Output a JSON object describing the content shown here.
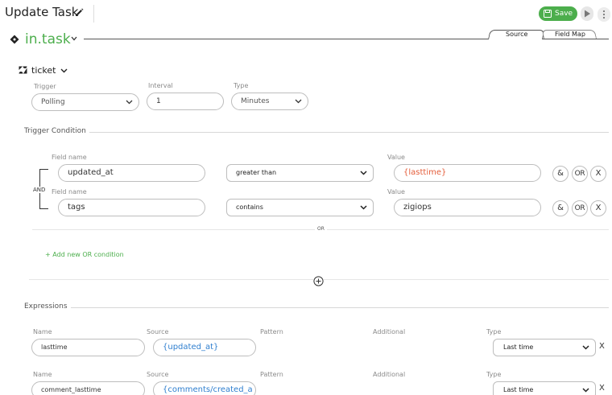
{
  "header": {
    "title": "Update Task",
    "save_label": "Save",
    "app_name": "in.task",
    "tabs": [
      {
        "label": "Source"
      },
      {
        "label": "Field Map"
      }
    ]
  },
  "source": {
    "entity": "ticket",
    "trigger_label": "Trigger",
    "trigger_value": "Polling",
    "interval_label": "Interval",
    "interval_value": "1",
    "type_label": "Type",
    "type_value": "Minutes"
  },
  "trigger_condition": {
    "title": "Trigger Condition",
    "and_label": "AND",
    "or_label": "OR",
    "add_or_label": "+ Add new OR condition",
    "rows": [
      {
        "field_label": "Field name",
        "field": "updated_at",
        "operator": "greater than",
        "value_label": "Value",
        "value": "{lasttime}",
        "and_btn": "&",
        "or_btn": "OR",
        "x_btn": "X"
      },
      {
        "field_label": "Field name",
        "field": "tags",
        "operator": "contains",
        "value_label": "Value",
        "value": "zigiops",
        "and_btn": "&",
        "or_btn": "OR",
        "x_btn": "X"
      }
    ]
  },
  "expressions": {
    "title": "Expressions",
    "rows": [
      {
        "name_label": "Name",
        "name": "lasttime",
        "source_label": "Source",
        "source": "{updated_at}",
        "pattern_label": "Pattern",
        "additional_label": "Additional",
        "type_label": "Type",
        "type": "Last time",
        "remove": "X"
      },
      {
        "name_label": "Name",
        "name": "comment_lasttime",
        "source_label": "Source",
        "source": "{comments/created_a",
        "pattern_label": "Pattern",
        "additional_label": "Additional",
        "type_label": "Type",
        "type": "Last time",
        "remove": "X"
      }
    ]
  },
  "colors": {
    "accent": "#4cae4c",
    "link_blue": "#2f7fcf",
    "value_red": "#e45d3a"
  }
}
